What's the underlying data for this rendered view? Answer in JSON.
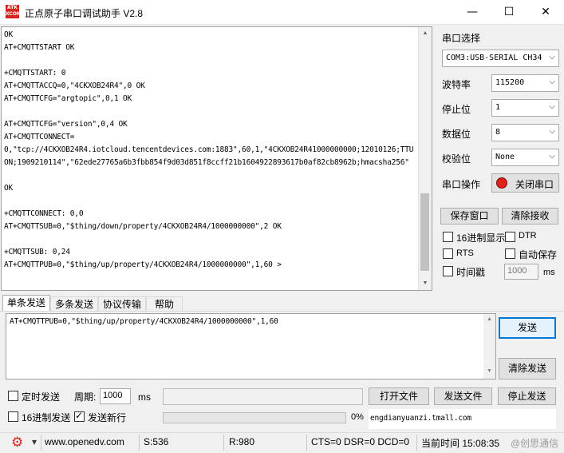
{
  "window": {
    "title": "正点原子串口调试助手 V2.8",
    "icon_text": "ATK XCOM",
    "minimize_glyph": "—",
    "maximize_glyph": "☐",
    "close_glyph": "✕"
  },
  "receive": {
    "text": "OK\nAT+CMQTTSTART OK\n\n+CMQTTSTART: 0\nAT+CMQTTACCQ=0,\"4CKXOB24R4\",0 OK\nAT+CMQTTCFG=\"argtopic\",0,1 OK\n\nAT+CMQTTCFG=\"version\",0,4 OK\nAT+CMQTTCONNECT=\n0,\"tcp://4CKXOB24R4.iotcloud.tencentdevices.com:1883\",60,1,\"4CKXOB24R41000000000;12010126;TTUON;1909210114\",\"62ede27765a6b3fbb854f9d03d851f8ccff21b1604922893617b0af82cb8962b;hmacsha256\"\n\nOK\n\n+CMQTTCONNECT: 0,0\nAT+CMQTTSUB=0,\"$thing/down/property/4CKXOB24R4/1000000000\",2 OK\n\n+CMQTTSUB: 0,24\nAT+CMQTTPUB=0,\"$thing/up/property/4CKXOB24R4/1000000000\",1,60 >"
  },
  "settings": {
    "port_select_label": "串口选择",
    "port_value": "COM3:USB-SERIAL CH340",
    "baud_label": "波特率",
    "baud_value": "115200",
    "stop_label": "停止位",
    "stop_value": "1",
    "data_label": "数据位",
    "data_value": "8",
    "parity_label": "校验位",
    "parity_value": "None",
    "port_op_label": "串口操作",
    "close_port_button": "关闭串口",
    "save_window_button": "保存窗口",
    "clear_receive_button": "清除接收",
    "hex_display_label": "16进制显示",
    "dtr_label": "DTR",
    "rts_label": "RTS",
    "auto_save_label": "自动保存",
    "timestamp_label": "时间戳",
    "timestamp_ms": "1000",
    "timestamp_unit": "ms"
  },
  "tabs": [
    "单条发送",
    "多条发送",
    "协议传输",
    "帮助"
  ],
  "send": {
    "text": "AT+CMQTTPUB=0,\"$thing/up/property/4CKXOB24R4/1000000000\",1,60",
    "send_button": "发送",
    "clear_send_button": "清除发送"
  },
  "bottom": {
    "timed_send_label": "定时发送",
    "period_label": "周期:",
    "period_value": "1000",
    "period_unit": "ms",
    "open_file_button": "打开文件",
    "send_file_button": "发送文件",
    "stop_send_button": "停止发送",
    "hex_send_label": "16进制发送",
    "send_newline_label": "发送新行",
    "progress_percent": "0%",
    "progress_fraction": 0,
    "tmall_text": "engdianyuanzi.tmall.com"
  },
  "status": {
    "gear_glyph": "⚙",
    "dropdown_glyph": "▾",
    "website": "www.openedv.com",
    "sent": "S:536",
    "received": "R:980",
    "lines": "CTS=0 DSR=0 DCD=0",
    "time": "当前时间 15:08:35",
    "watermark": "@创思通信"
  },
  "colors": {
    "accent": "#0078d7",
    "close_port_icon": "#e0201c",
    "gear": "#d9261c"
  }
}
